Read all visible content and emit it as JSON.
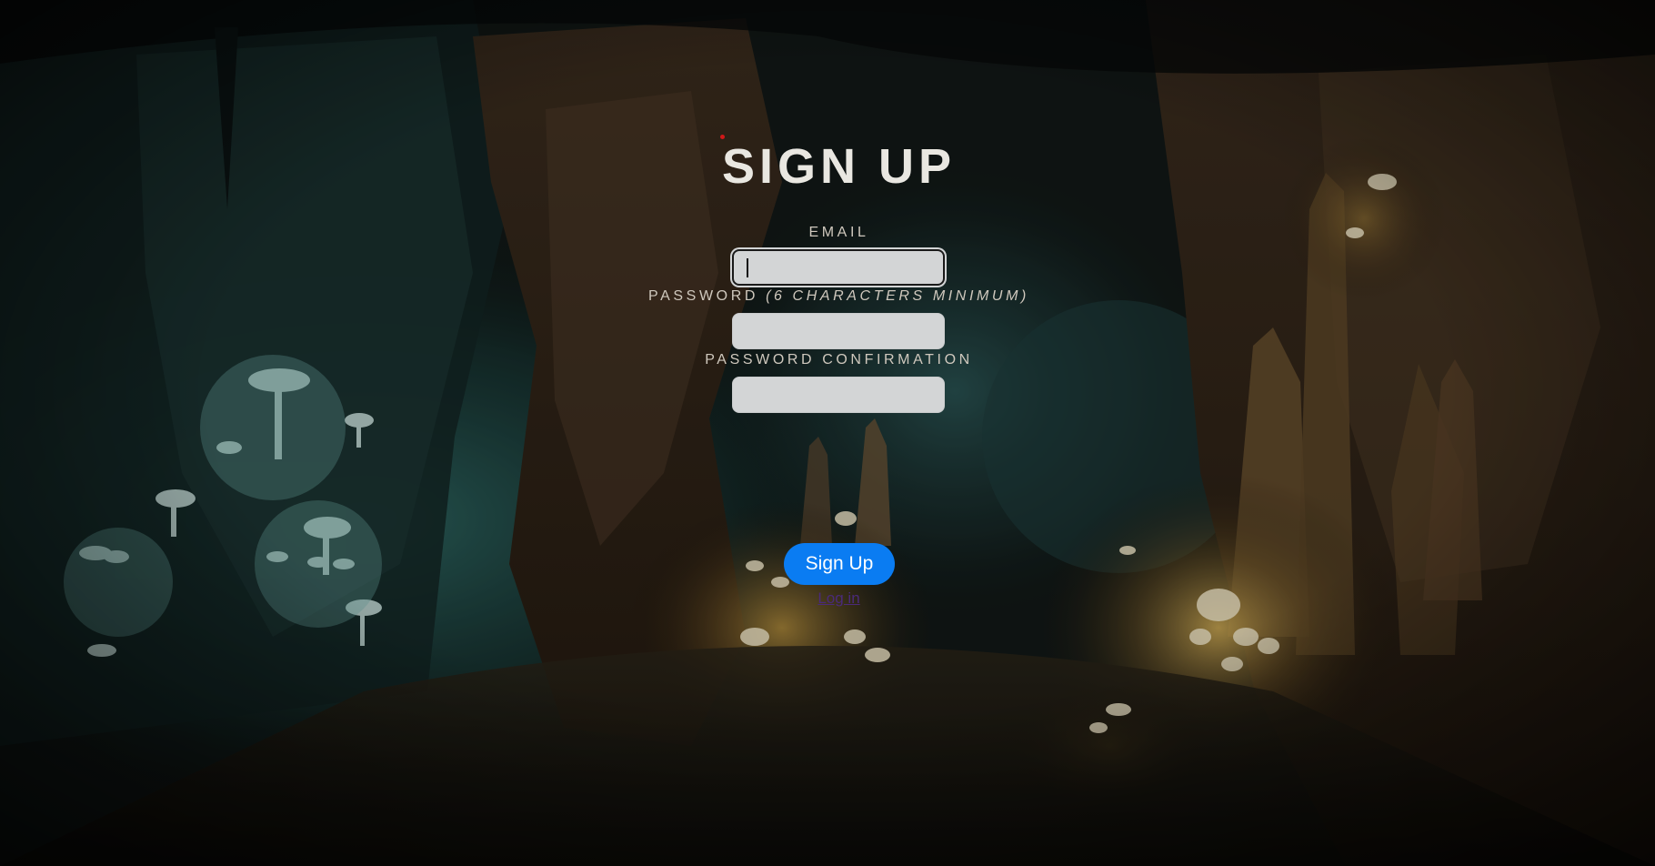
{
  "page": {
    "title": "SIGN UP"
  },
  "form": {
    "email_label": "EMAIL",
    "email_value": "",
    "password_label": "PASSWORD ",
    "password_hint": "(6 CHARACTERS MINIMUM)",
    "password_value": "",
    "confirmation_label": "PASSWORD CONFIRMATION",
    "confirmation_value": "",
    "submit_label": "Sign Up",
    "login_link": "Log in"
  },
  "colors": {
    "button": "#0a7cf2",
    "title": "#e9e7e1",
    "field_background": "#d3d5d6",
    "link": "#4a2a7a"
  },
  "background": {
    "description_icon": "cave-mushrooms-image"
  }
}
